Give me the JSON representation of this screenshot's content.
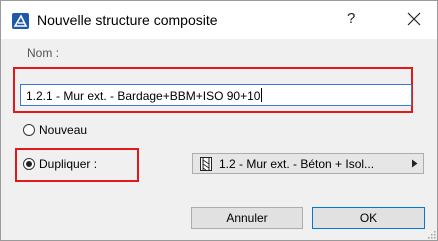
{
  "window": {
    "title": "Nouvelle structure composite",
    "help": "?"
  },
  "name": {
    "label": "Nom :",
    "value": "1.2.1 - Mur ext. - Bardage+BBM+ISO 90+10"
  },
  "options": {
    "new_label": "Nouveau",
    "new_selected": false,
    "duplicate_label": "Dupliquer :",
    "duplicate_selected": true
  },
  "source_dropdown": {
    "value": "1.2 - Mur ext. - Béton + Isol..."
  },
  "buttons": {
    "cancel": "Annuler",
    "ok": "OK"
  },
  "colors": {
    "highlight": "#e2191b",
    "focus": "#3a78d8",
    "app_icon": "#1e5aa8"
  }
}
